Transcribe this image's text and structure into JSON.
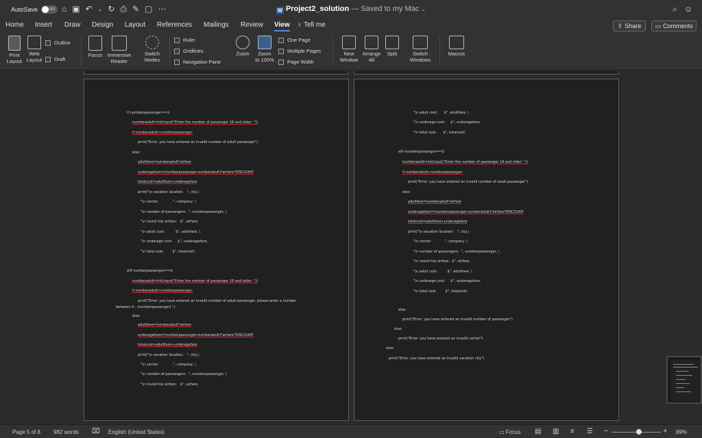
{
  "titlebar": {
    "autosave_label": "AutoSave",
    "autosave_state": "OFF",
    "doc_name": "Project2_solution",
    "doc_suffix": " — Saved to my Mac",
    "qa_icons": [
      "home-icon",
      "save-icon",
      "undo-icon",
      "redo-icon",
      "print-icon",
      "format-painter-icon",
      "new-doc-icon",
      "more-icon"
    ]
  },
  "tabs": [
    "Home",
    "Insert",
    "Draw",
    "Design",
    "Layout",
    "References",
    "Mailings",
    "Review",
    "View"
  ],
  "active_tab": "View",
  "tell_me": "Tell me",
  "share_label": "Share",
  "comments_label": "Comments",
  "ribbon": {
    "print_layout": "Print\nLayout",
    "web_layout": "Web\nLayout",
    "outline": "Outline",
    "draft": "Draft",
    "focus": "Focus",
    "immersive_reader": "Immersive\nReader",
    "switch_modes": "Switch\nModes",
    "ruler": "Ruler",
    "gridlines": "Gridlines",
    "navigation_pane": "Navigation Pane",
    "zoom": "Zoom",
    "zoom_100": "Zoom\nto 100%",
    "one_page": "One Page",
    "multiple_pages": "Multiple Pages",
    "page_width": "Page Width",
    "new_window": "New\nWindow",
    "arrange_all": "Arrange\nAll",
    "split": "Split",
    "switch_windows": "Switch\nWindows",
    "macros": "Macros"
  },
  "page1_lines": [
    "if numberpassenger==1:",
    "numberadult=int(input(\"Enter the number of passenger 18 and older: \"))",
    "if numberadult>numberpassenger:",
    "print(\"Error: you have entered an invalid number of adult passenger\")",
    "else:",
    "adultfare=numberadult*airfare",
    "underagefare=(numberpassenger-numberadult)*airfare*DISCOUNT",
    "totalcost=adultfare+underagefare",
    "print(\"\\n vacation location:   \", city,\\",
    "\"\\n carrier:             \", company, \\",
    "\"\\n number of passengers:  \", numberpassenger, \\",
    "\"\\n round trip airfare:   $\", airfare,",
    "\"\\n adult cost:          $\", adultfare, \\",
    "\"\\n underage cost:     $\", underagefare,",
    "\"\\n total cost:        $\", totalcost)",
    "elif numberpassenger==2:",
    "numberadult=int(input(\"Enter the number of passenger 18 and older: \"))",
    "if numberadult>numberpassenger:",
    "print(\"Error: you have entered an invalid number of adult passenger, please enter a number",
    "between 0 , (numberpassenger) \")",
    "else:",
    "adultfare=numberadult*airfare",
    "underagefare=(numberpassenger-numberadult)*airfare*DISCOUNT",
    "totalcost=adultfare+underagefare",
    "print(\"\\n vacation location:   \", city,\\",
    "\"\\n carrier:             \", company, \\",
    "\"\\n number of passengers:  \", numberpassenger, \\",
    "\"\\n round trip airfare:   $\", airfare,"
  ],
  "page2_lines": [
    "\"\\n adult cost:      $\", adultfare, \\",
    "\"\\n underage cost:     $\", underagefare,",
    "\"\\n total cost:      $\", totalcost)",
    "elif numberpassenger==3:",
    "numberadult=int(input(\"Enter the number of passenger 18 and older: \"))",
    "if numberadult>numberpassenger:",
    "print(\"Error: you have entered an invalid number of adult passenger\")",
    "else:",
    "adultfare=numberadult*airfare",
    "underagefare=(numberpassenger-numberadult)*airfare*DISCOUNT",
    "totalcost=adultfare+underagefare",
    "print(\"\\n vacation location:   \", city,\\",
    "\"\\n carrier:            \", company, \\",
    "\"\\n number of passengers:  \", numberpassenger, \\",
    "\"\\n round trip airfare:  $\", airfare,",
    "\"\\n adult cost:         $\", adultfare, \\",
    "\"\\n underage cost:     $\", underagefare,",
    "\"\\n total cost:        $\", totalcost)",
    "else:",
    "print(\"Error: you have entered an invalid number of passenger\")",
    "else:",
    "print(\"Error: you have entered an invalid carrier\")",
    "else:",
    "print(\"Error: you have entered an invalid vacation city\")"
  ],
  "status": {
    "page": "Page 5 of 8",
    "words": "982 words",
    "language": "English (United States)",
    "focus": "Focus",
    "zoom": "89%",
    "zoom_level": 0.55
  }
}
